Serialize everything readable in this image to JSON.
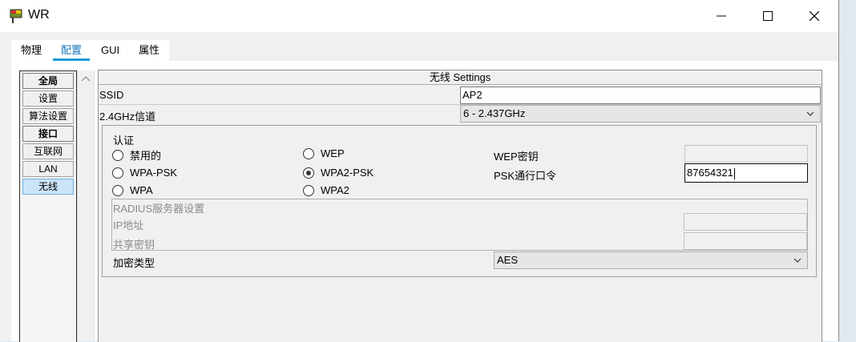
{
  "window": {
    "title": "WR"
  },
  "tabs": [
    {
      "label": "物理"
    },
    {
      "label": "配置"
    },
    {
      "label": "GUI"
    },
    {
      "label": "属性"
    }
  ],
  "active_tab": "配置",
  "sidebar": {
    "items": [
      {
        "label": "全局",
        "kind": "header"
      },
      {
        "label": "设置",
        "kind": "item"
      },
      {
        "label": "算法设置",
        "kind": "item"
      },
      {
        "label": "接口",
        "kind": "header"
      },
      {
        "label": "互联网",
        "kind": "item"
      },
      {
        "label": "LAN",
        "kind": "item"
      },
      {
        "label": "无线",
        "kind": "item",
        "selected": true
      }
    ]
  },
  "panel": {
    "title": "无线 Settings",
    "ssid_label": "SSID",
    "ssid_value": "AP2",
    "channel_label": "2.4GHz信道",
    "channel_value": "6 - 2.437GHz",
    "auth": {
      "label": "认证",
      "options": [
        {
          "label": "禁用的",
          "checked": false
        },
        {
          "label": "WEP",
          "checked": false
        },
        {
          "label": "WPA-PSK",
          "checked": false
        },
        {
          "label": "WPA2-PSK",
          "checked": true
        },
        {
          "label": "WPA",
          "checked": false
        },
        {
          "label": "WPA2",
          "checked": false
        }
      ],
      "wep_key_label": "WEP密钥",
      "wep_key_value": "",
      "psk_label": "PSK通行口令",
      "psk_value": "87654321"
    },
    "radius": {
      "title": "RADIUS服务器设置",
      "ip_label": "IP地址",
      "ip_value": "",
      "secret_label": "共享密钥",
      "secret_value": ""
    },
    "encryption_label": "加密类型",
    "encryption_value": "AES"
  },
  "colors": {
    "tab_active": "#1a73b8",
    "tab_underline": "#1a9bd7",
    "sidebar_selected": "#cce4f7"
  }
}
